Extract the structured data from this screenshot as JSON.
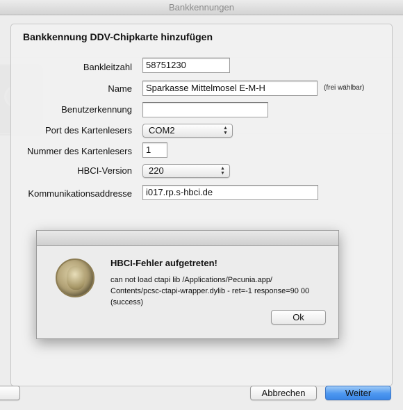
{
  "window": {
    "title": "Bankkennungen"
  },
  "sheet": {
    "title": "Bankkennung DDV-Chipkarte hinzufügen",
    "fields": {
      "bankleitzahl": {
        "label": "Bankleitzahl",
        "value": "58751230"
      },
      "name": {
        "label": "Name",
        "value": "Sparkasse Mittelmosel E-M-H",
        "hint": "(frei wählbar)"
      },
      "benutzerkennung": {
        "label": "Benutzerkennung",
        "value": ""
      },
      "port": {
        "label": "Port des Kartenlesers",
        "value": "COM2"
      },
      "nummer": {
        "label": "Nummer des Kartenlesers",
        "value": "1"
      },
      "hbci_version": {
        "label": "HBCI-Version",
        "value": "220"
      },
      "kommunikationsaddresse": {
        "label": "Kommunikationsaddresse",
        "value": "i017.rp.s-hbci.de"
      }
    },
    "buttons": {
      "cancel": "Abbrechen",
      "next": "Weiter",
      "left": ""
    }
  },
  "alert": {
    "heading": "HBCI-Fehler aufgetreten!",
    "message": "can not load ctapi lib /Applications/Pecunia.app/ Contents/pcsc-ctapi-wrapper.dylib - ret=-1 response=90 00 (success)",
    "ok": "Ok",
    "icon": "coin-icon"
  },
  "colors": {
    "primary_button": "#4d97f0"
  }
}
